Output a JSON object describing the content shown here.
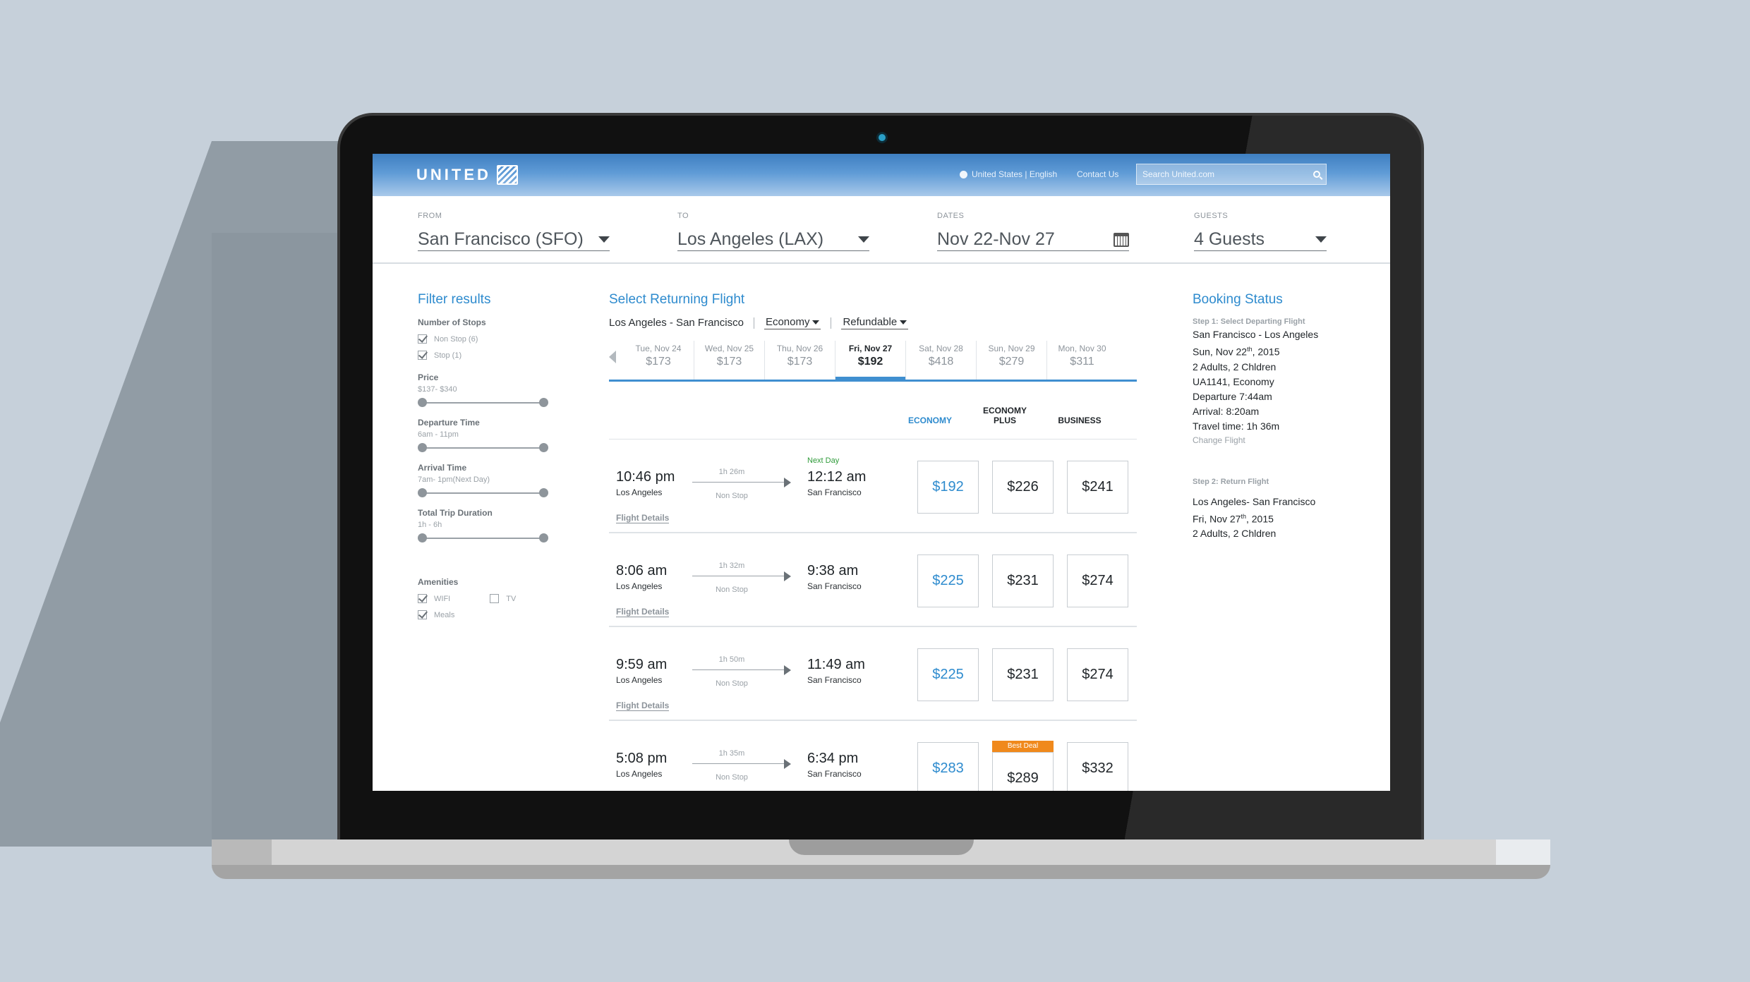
{
  "header": {
    "logo": "UNITED",
    "locale": "United States | English",
    "contact": "Contact Us",
    "search_placeholder": "Search United.com"
  },
  "criteria": {
    "from_label": "FROM",
    "from_value": "San Francisco (SFO)",
    "to_label": "TO",
    "to_value": "Los Angeles (LAX)",
    "dates_label": "DATES",
    "dates_value": "Nov 22-Nov 27",
    "guests_label": "GUESTS",
    "guests_value": "4 Guests"
  },
  "filters": {
    "title": "Filter results",
    "stops_label": "Number of Stops",
    "nonstop": "Non Stop (6)",
    "stop": "Stop (1)",
    "price_label": "Price",
    "price_range": "$137- $340",
    "departure_label": "Departure Time",
    "departure_range": "6am - 11pm",
    "arrival_label": "Arrival Time",
    "arrival_range": "7am- 1pm(Next Day)",
    "duration_label": "Total Trip Duration",
    "duration_range": "1h - 6h",
    "amenities_label": "Amenities",
    "wifi": "WIFI",
    "tv": "TV",
    "meals": "Meals"
  },
  "results": {
    "title": "Select Returning Flight",
    "route": "Los Angeles - San Francisco",
    "cabin": "Economy",
    "fare": "Refundable",
    "dates": [
      {
        "day": "Tue, Nov 24",
        "price": "$173"
      },
      {
        "day": "Wed, Nov 25",
        "price": "$173"
      },
      {
        "day": "Thu, Nov 26",
        "price": "$173"
      },
      {
        "day": "Fri, Nov 27",
        "price": "$192"
      },
      {
        "day": "Sat, Nov 28",
        "price": "$418"
      },
      {
        "day": "Sun, Nov 29",
        "price": "$279"
      },
      {
        "day": "Mon, Nov 30",
        "price": "$311"
      }
    ],
    "col_economy": "ECONOMY",
    "col_economy_plus": "ECONOMY PLUS",
    "col_business": "BUSINESS",
    "details_label": "Flight Details",
    "best_deal": "Best Deal",
    "flights": [
      {
        "dep": "10:46 pm",
        "from": "Los Angeles",
        "dur": "1h 26m",
        "stops": "Non Stop",
        "next": "Next Day",
        "arr": "12:12 am",
        "to": "San Francisco",
        "economy": "$192",
        "plus": "$226",
        "business": "$241"
      },
      {
        "dep": "8:06 am",
        "from": "Los Angeles",
        "dur": "1h 32m",
        "stops": "Non Stop",
        "next": "",
        "arr": "9:38 am",
        "to": "San Francisco",
        "economy": "$225",
        "plus": "$231",
        "business": "$274"
      },
      {
        "dep": "9:59 am",
        "from": "Los Angeles",
        "dur": "1h 50m",
        "stops": "Non Stop",
        "next": "",
        "arr": "11:49 am",
        "to": "San Francisco",
        "economy": "$225",
        "plus": "$231",
        "business": "$274"
      },
      {
        "dep": "5:08 pm",
        "from": "Los Angeles",
        "dur": "1h 35m",
        "stops": "Non Stop",
        "next": "",
        "arr": "6:34 pm",
        "to": "San Francisco",
        "economy": "$283",
        "plus": "$289",
        "business": "$332"
      }
    ]
  },
  "booking": {
    "title": "Booking Status",
    "step1": "Step 1: Select Departing Flight",
    "s1_route": "San Francisco - Los Angeles",
    "s1_date": "Sun, Nov 22",
    "s1_date_sup": "th",
    "s1_year": ", 2015",
    "s1_pax": "2 Adults, 2 Chldren",
    "s1_flight": "UA1141, Economy",
    "s1_dep": "Departure 7:44am",
    "s1_arr": "Arrival: 8:20am",
    "s1_time": "Travel time: 1h 36m",
    "change": "Change Flight",
    "step2": "Step 2: Return Flight",
    "s2_route": "Los Angeles- San Francisco",
    "s2_date": "Fri, Nov 27",
    "s2_date_sup": "th",
    "s2_year": ", 2015",
    "s2_pax": "2 Adults, 2 Chldren"
  }
}
